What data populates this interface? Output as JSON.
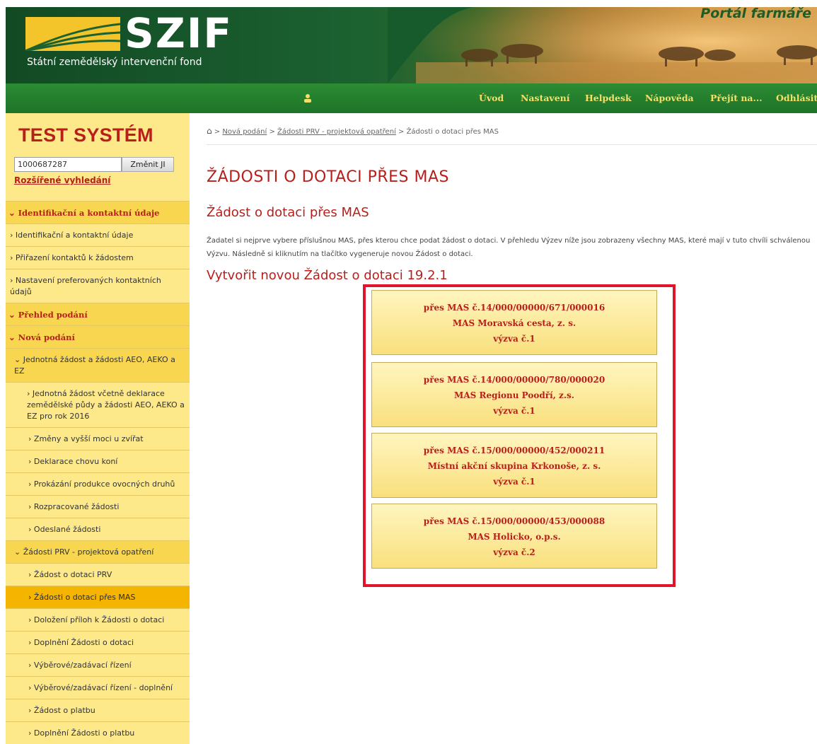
{
  "header": {
    "logo": "SZIF",
    "subtitle": "Státní zemědělský intervenční fond",
    "portal_title": "Portál farmáře"
  },
  "nav": {
    "items": [
      "Úvod",
      "Nastavení",
      "Helpdesk",
      "Nápověda",
      "Přejít na...",
      "Odhlásit"
    ]
  },
  "sidebar": {
    "system_title": "TEST SYSTÉM",
    "search": {
      "value": "1000687287",
      "button": "Změnit JI",
      "advanced": "Rozšířené vyhledání"
    },
    "menu": [
      {
        "label": "Identifikační a kontaktní údaje"
      },
      {
        "label": "Identifikační a kontaktní údaje"
      },
      {
        "label": "Přiřazení kontaktů k žádostem"
      },
      {
        "label": "Nastavení preferovaných kontaktních údajů"
      },
      {
        "label": "Přehled podání"
      },
      {
        "label": "Nová podání"
      },
      {
        "label": "Jednotná žádost a žádosti AEO, AEKO a EZ"
      },
      {
        "label": "Jednotná žádost včetně deklarace zemědělské půdy a žádosti AEO, AEKO a EZ pro rok 2016"
      },
      {
        "label": "Změny a vyšší moci u zvířat"
      },
      {
        "label": "Deklarace chovu koní"
      },
      {
        "label": "Prokázání produkce ovocných druhů"
      },
      {
        "label": "Rozpracované žádosti"
      },
      {
        "label": "Odeslané žádosti"
      },
      {
        "label": "Žádosti PRV - projektová opatření"
      },
      {
        "label": "Žádost o dotaci PRV"
      },
      {
        "label": "Žádosti o dotaci přes MAS"
      },
      {
        "label": "Doložení příloh k Žádosti o dotaci"
      },
      {
        "label": "Doplnění Žádosti o dotaci"
      },
      {
        "label": "Výběrové/zadávací řízení"
      },
      {
        "label": "Výběrové/zadávací řízení - doplnění"
      },
      {
        "label": "Žádost o platbu"
      },
      {
        "label": "Doplnění Žádosti o platbu"
      }
    ]
  },
  "breadcrumb": {
    "items": [
      "Nová podání",
      "Žádosti PRV - projektová opatření"
    ],
    "current": "Žádosti o dotaci přes MAS"
  },
  "main": {
    "title": "ŽÁDOSTI O DOTACI PŘES MAS",
    "section_title": "Žádost o dotaci přes MAS",
    "description": "Žadatel si nejprve vybere příslušnou MAS, přes kterou chce podat žádost o dotaci. V přehledu Výzev níže jsou zobrazeny všechny MAS, které mají v tuto chvíli schválenou Výzvu. Následně si kliknutím na tlačítko vygeneruje novou Žádost o dotaci.",
    "create_title": "Vytvořit novou Žádost o dotaci 19.2.1",
    "mas_buttons": [
      {
        "line1": "přes MAS č.14/000/00000/671/000016",
        "line2": "MAS Moravská cesta, z. s.",
        "line3": "výzva č.1"
      },
      {
        "line1": "přes MAS č.14/000/00000/780/000020",
        "line2": "MAS Regionu Poodří, z.s.",
        "line3": "výzva č.1"
      },
      {
        "line1": "přes MAS č.15/000/00000/452/000211",
        "line2": "Místní akční skupina Krkonoše, z. s.",
        "line3": "výzva č.1"
      },
      {
        "line1": "přes MAS č.15/000/00000/453/000088",
        "line2": "MAS Holicko, o.p.s.",
        "line3": "výzva č.2"
      }
    ]
  },
  "colors": {
    "brand_red": "#b81f1a",
    "nav_green": "#1e7329",
    "sidebar_yellow": "#fde88a",
    "active_orange": "#f5b400",
    "highlight_red": "#e0142b"
  }
}
